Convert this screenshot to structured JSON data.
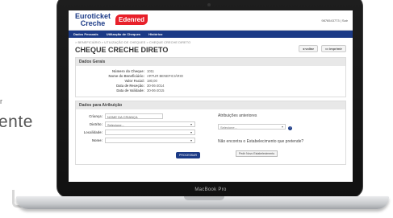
{
  "page": {
    "side_text": "ente",
    "side_mark": "r"
  },
  "laptop": {
    "brand_label": "MacBook Pro"
  },
  "app": {
    "logo_line1": "Euroticket",
    "logo_line2": "Creche",
    "logo_brand": "Edenred",
    "user_label": "9876543773 | Sair",
    "nav": [
      "Dados Pessoais",
      "Utilização de Cheques",
      "Histórico"
    ],
    "breadcrumb": "> BENEFICIÁRIO > UTILIZAÇÃO DE CHEQUES > CHEQUE CRECHE DIRETO",
    "page_title": "CHEQUE CRECHE DIRETO",
    "buttons": {
      "voltar": "voltar",
      "imprimir": "imprimir"
    },
    "dados_gerais": {
      "heading": "Dados Gerais",
      "rows": [
        {
          "label": "Número do Cheque:",
          "value": "1011"
        },
        {
          "label": "Nome do Beneficiário:",
          "value": "ARTUR BENEFICIÁRIO"
        },
        {
          "label": "Valor Facial:",
          "value": "180,00"
        },
        {
          "label": "Data de Receção:",
          "value": "30-06-2014"
        },
        {
          "label": "Data de Validade:",
          "value": "30-06-2015"
        }
      ]
    },
    "atribuicao": {
      "heading": "Dados para Atribuição",
      "crianca_label": "Criança:",
      "crianca_value": "NOME DA CRIANÇA",
      "distrito_label": "Distrito:",
      "distrito_value": "Selecione...",
      "localidade_label": "Localidade:",
      "localidade_value": "",
      "nome_label": "Nome:",
      "nome_value": "",
      "processar": "PROCESSAR",
      "anteriores_label": "Atribuições anteriores",
      "anteriores_value": "Selecione...",
      "help_icon": "?",
      "not_found": "Não encontra o Estabelecimento que pretende?",
      "pedir_button": "Pedir Novo Estabelecimento"
    }
  }
}
